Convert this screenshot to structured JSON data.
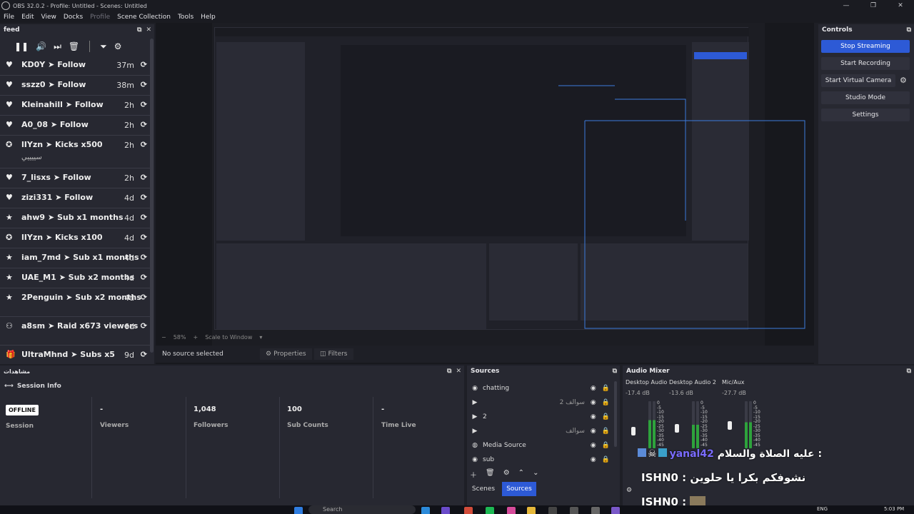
{
  "window": {
    "title": "OBS 32.0.2 - Profile: Untitled - Scenes: Untitled"
  },
  "menu": [
    "File",
    "Edit",
    "View",
    "Docks",
    "Profile",
    "Scene Collection",
    "Tools",
    "Help"
  ],
  "feed": {
    "title": "feed",
    "items": [
      {
        "icon": "heart-icon",
        "user": "KD0Y",
        "action": "Follow",
        "time": "37m"
      },
      {
        "icon": "heart-icon",
        "user": "sszz0",
        "action": "Follow",
        "time": "38m"
      },
      {
        "icon": "heart-icon",
        "user": "Kleinahill",
        "action": "Follow",
        "time": "2h"
      },
      {
        "icon": "heart-icon",
        "user": "A0_08",
        "action": "Follow",
        "time": "2h"
      },
      {
        "icon": "kick-icon",
        "user": "lIYzn",
        "action": "Kicks x500",
        "time": "2h",
        "extra": "سييييي"
      },
      {
        "icon": "heart-icon",
        "user": "7_lisxs",
        "action": "Follow",
        "time": "2h"
      },
      {
        "icon": "heart-icon",
        "user": "zizi331",
        "action": "Follow",
        "time": "4d"
      },
      {
        "icon": "star-icon",
        "user": "ahw9",
        "action": "Sub x1 months",
        "time": "4d"
      },
      {
        "icon": "kick-icon",
        "user": "lIYzn",
        "action": "Kicks x100",
        "time": "4d"
      },
      {
        "icon": "star-icon",
        "user": "iam_7md",
        "action": "Sub x1 months",
        "time": "4d"
      },
      {
        "icon": "star-icon",
        "user": "UAE_M1",
        "action": "Sub x2 months",
        "time": "4d"
      },
      {
        "icon": "star-icon",
        "user": "2Penguin",
        "action": "Sub x2 months",
        "time": "4d"
      },
      {
        "icon": "raid-icon",
        "user": "a8sm",
        "action": "Raid x673 viewers",
        "time": "6d"
      },
      {
        "icon": "gift-icon",
        "user": "UltraMhnd",
        "action": "Subs x5",
        "time": "9d"
      }
    ]
  },
  "preview": {
    "no_source": "No source selected",
    "properties": "Properties",
    "filters": "Filters",
    "zoom": "58%",
    "scale": "Scale to Window"
  },
  "controls": {
    "title": "Controls",
    "stop_streaming": "Stop Streaming",
    "start_recording": "Start Recording",
    "start_virtual_camera": "Start Virtual Camera",
    "studio_mode": "Studio Mode",
    "settings": "Settings"
  },
  "session": {
    "dock_title": "مشاهدات",
    "title": "Session Info",
    "badge": "OFFLINE",
    "session_label": "Session",
    "viewers_value": "-",
    "viewers_label": "Viewers",
    "followers_value": "1,048",
    "followers_label": "Followers",
    "subs_value": "100",
    "subs_label": "Sub Counts",
    "time_value": "-",
    "time_label": "Time Live"
  },
  "sources": {
    "title": "Sources",
    "items": [
      {
        "icon": "chat-icon",
        "name": "chatting",
        "rtl": ""
      },
      {
        "icon": "play-icon",
        "name": "",
        "rtl": "سوالف 2"
      },
      {
        "icon": "play-icon",
        "name": "2",
        "rtl": ""
      },
      {
        "icon": "play-icon",
        "name": "",
        "rtl": "سوالف"
      },
      {
        "icon": "media-icon",
        "name": "Media Source",
        "rtl": ""
      },
      {
        "icon": "audio-icon",
        "name": "sub",
        "rtl": ""
      }
    ],
    "tab_scenes": "Scenes",
    "tab_sources": "Sources"
  },
  "mixer": {
    "title": "Audio Mixer",
    "channels": [
      {
        "name": "Desktop Audio",
        "db": "-17.4 dB",
        "level": 0.6
      },
      {
        "name": "Desktop Audio 2",
        "db": "-13.6 dB",
        "level": 0.5
      },
      {
        "name": "Mic/Aux",
        "db": "-27.7 dB",
        "level": 0.55
      }
    ],
    "scale": [
      "0",
      "-5",
      "-10",
      "-15",
      "-20",
      "-25",
      "-30",
      "-35",
      "-40",
      "-45"
    ]
  },
  "chat": {
    "line1_user": "yanal42",
    "line1_msg": "عليه الصلاة والسلام :",
    "line2_user": "ISHN0",
    "line2_msg": ": نشوفكم بكرا يا حلوين",
    "line3_user": "ISHN0 :"
  },
  "taskbar": {
    "search": "Search",
    "lang": "ENG",
    "time": "5:03 PM"
  },
  "colors": {
    "accent": "#2d5ad6",
    "bg": "#1e1f26",
    "panel": "#272831"
  }
}
